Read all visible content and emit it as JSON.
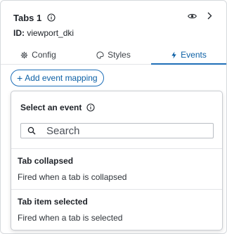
{
  "header": {
    "title": "Tabs 1",
    "id_label": "ID:",
    "id_value": "viewport_dki"
  },
  "tabs": [
    {
      "label": "Config",
      "icon": "gear-icon",
      "active": false
    },
    {
      "label": "Styles",
      "icon": "palette-icon",
      "active": false
    },
    {
      "label": "Events",
      "icon": "lightning-icon",
      "active": true
    }
  ],
  "add_mapping_label": "Add event mapping",
  "dropdown": {
    "title": "Select an event",
    "search_placeholder": "Search",
    "events": [
      {
        "name": "Tab collapsed",
        "description": "Fired when a tab is collapsed"
      },
      {
        "name": "Tab item selected",
        "description": "Fired when a tab is selected"
      }
    ]
  },
  "colors": {
    "accent": "#1f6fb8",
    "text": "#1f2329",
    "border": "#d6d9dd"
  }
}
